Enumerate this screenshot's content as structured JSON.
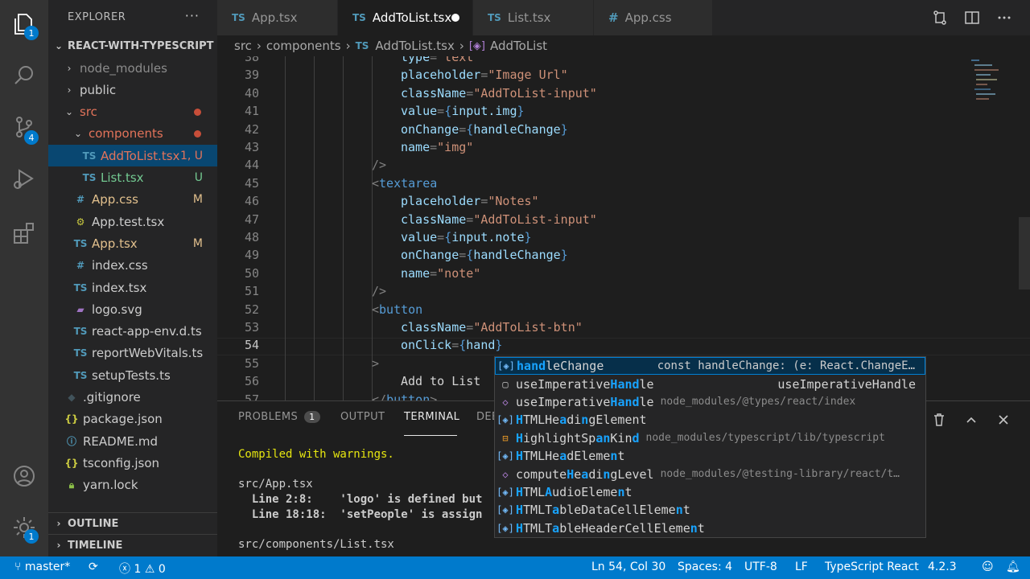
{
  "activity_bar": {
    "explorer_badge": "1",
    "source_control_badge": "4",
    "settings_badge": "1"
  },
  "sidebar": {
    "title": "EXPLORER",
    "more": "···",
    "root": "REACT-WITH-TYPESCRIPT",
    "items": [
      {
        "label": "node_modules",
        "kind": "folder",
        "color": "#8b8b8b"
      },
      {
        "label": "public",
        "kind": "folder",
        "color": "#cccccc"
      },
      {
        "label": "src",
        "kind": "folder-open",
        "color": "#e2735a"
      },
      {
        "label": "components",
        "kind": "folder-open",
        "color": "#e2735a"
      },
      {
        "label": "AddToList.tsx",
        "kind": "ts",
        "color": "#e2735a",
        "decoration": "1, U"
      },
      {
        "label": "List.tsx",
        "kind": "ts",
        "color": "#73c991",
        "decoration": "U"
      },
      {
        "label": "App.css",
        "kind": "css",
        "color": "#e2c08d",
        "decoration": "M"
      },
      {
        "label": "App.test.tsx",
        "kind": "test",
        "color": "#cccccc"
      },
      {
        "label": "App.tsx",
        "kind": "ts",
        "color": "#e2c08d",
        "decoration": "M"
      },
      {
        "label": "index.css",
        "kind": "css",
        "color": "#cccccc"
      },
      {
        "label": "index.tsx",
        "kind": "ts",
        "color": "#cccccc"
      },
      {
        "label": "logo.svg",
        "kind": "svg",
        "color": "#cccccc"
      },
      {
        "label": "react-app-env.d.ts",
        "kind": "ts",
        "color": "#cccccc"
      },
      {
        "label": "reportWebVitals.ts",
        "kind": "ts",
        "color": "#cccccc"
      },
      {
        "label": "setupTests.ts",
        "kind": "ts",
        "color": "#cccccc"
      },
      {
        "label": ".gitignore",
        "kind": "git",
        "color": "#cccccc"
      },
      {
        "label": "package.json",
        "kind": "json",
        "color": "#cccccc"
      },
      {
        "label": "README.md",
        "kind": "info",
        "color": "#cccccc"
      },
      {
        "label": "tsconfig.json",
        "kind": "json",
        "color": "#cccccc"
      },
      {
        "label": "yarn.lock",
        "kind": "lock",
        "color": "#cccccc"
      }
    ],
    "outline": "OUTLINE",
    "timeline": "TIMELINE"
  },
  "tabs": [
    {
      "label": "App.tsx",
      "badge": "TS"
    },
    {
      "label": "AddToList.tsx",
      "badge": "TS"
    },
    {
      "label": "List.tsx",
      "badge": "TS"
    },
    {
      "label": "App.css",
      "badge": "#"
    }
  ],
  "breadcrumb": {
    "parts": [
      "src",
      "components",
      "AddToList.tsx",
      "AddToList"
    ],
    "ts_badge": "TS"
  },
  "editor": {
    "lines": [
      {
        "n": "38",
        "text": "type=\"text\""
      },
      {
        "n": "39",
        "text": "placeholder=\"Image Url\""
      },
      {
        "n": "40",
        "text": "className=\"AddToList-input\""
      },
      {
        "n": "41",
        "text": "value={input.img}"
      },
      {
        "n": "42",
        "text": "onChange={handleChange}"
      },
      {
        "n": "43",
        "text": "name=\"img\""
      },
      {
        "n": "44",
        "text": "/>"
      },
      {
        "n": "45",
        "text": "<textarea"
      },
      {
        "n": "46",
        "text": "placeholder=\"Notes\""
      },
      {
        "n": "47",
        "text": "className=\"AddToList-input\""
      },
      {
        "n": "48",
        "text": "value={input.note}"
      },
      {
        "n": "49",
        "text": "onChange={handleChange}"
      },
      {
        "n": "50",
        "text": "name=\"note\""
      },
      {
        "n": "51",
        "text": "/>"
      },
      {
        "n": "52",
        "text": "<button"
      },
      {
        "n": "53",
        "text": "className=\"AddToList-btn\""
      },
      {
        "n": "54",
        "text": "onClick={hand}"
      },
      {
        "n": "55",
        "text": ">"
      },
      {
        "n": "56",
        "text": "Add to List"
      },
      {
        "n": "57",
        "text": "</button>"
      }
    ]
  },
  "suggest": {
    "items": [
      {
        "label": "handleChange",
        "detail": "const handleChange: (e: React.ChangeE…",
        "icon": "variable"
      },
      {
        "label": "useImperativeHandle",
        "detail": "useImperativeHandle",
        "icon": "text"
      },
      {
        "label": "useImperativeHandle",
        "detail": "node_modules/@types/react/index",
        "icon": "method"
      },
      {
        "label": "HTMLHeadingElement",
        "detail": "",
        "icon": "variable"
      },
      {
        "label": "HighlightSpanKind",
        "detail": "node_modules/typescript/lib/typescript",
        "icon": "enum"
      },
      {
        "label": "HTMLHeadElement",
        "detail": "",
        "icon": "variable"
      },
      {
        "label": "computeHeadingLevel",
        "detail": "node_modules/@testing-library/react/t…",
        "icon": "method"
      },
      {
        "label": "HTMLAudioElement",
        "detail": "",
        "icon": "variable"
      },
      {
        "label": "HTMLTableDataCellElement",
        "detail": "",
        "icon": "variable"
      },
      {
        "label": "HTMLTableHeaderCellElement",
        "detail": "",
        "icon": "variable"
      }
    ]
  },
  "panel": {
    "tabs": [
      "PROBLEMS",
      "OUTPUT",
      "TERMINAL",
      "DEB"
    ],
    "problems_count": "1",
    "terminal": [
      "Compiled with warnings.",
      "",
      "src/App.tsx",
      "  Line 2:8:    'logo' is defined but",
      "  Line 18:18:  'setPeople' is assign",
      "",
      "src/components/List.tsx"
    ]
  },
  "statusbar": {
    "branch": "master*",
    "errors": "1",
    "warnings": "0",
    "position": "Ln 54, Col 30",
    "spaces": "Spaces: 4",
    "encoding": "UTF-8",
    "eol": "LF",
    "language": "TypeScript React",
    "version": "4.2.3"
  }
}
